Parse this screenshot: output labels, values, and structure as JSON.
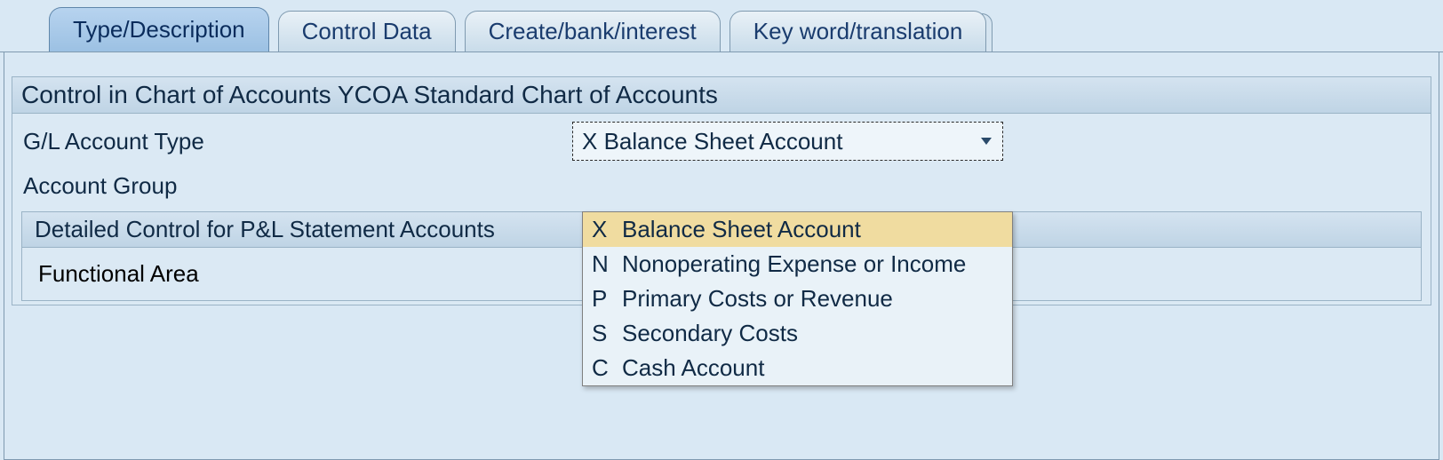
{
  "tabs": [
    {
      "label": "Type/Description",
      "active": true
    },
    {
      "label": "Control Data",
      "active": false
    },
    {
      "label": "Create/bank/interest",
      "active": false
    },
    {
      "label": "Key word/translation",
      "active": false
    }
  ],
  "group_header": "Control in Chart of Accounts YCOA Standard Chart of Accounts",
  "fields": {
    "gl_account_type_label": "G/L Account Type",
    "gl_account_type_value": "X  Balance Sheet Account",
    "account_group_label": "Account Group"
  },
  "inner": {
    "header": "Detailed Control for P&L Statement Accounts",
    "functional_area_label": "Functional Area"
  },
  "dropdown_items": [
    {
      "key": "X",
      "text": "Balance Sheet Account",
      "selected": true
    },
    {
      "key": "N",
      "text": "Nonoperating Expense or Income",
      "selected": false
    },
    {
      "key": "P",
      "text": "Primary Costs or Revenue",
      "selected": false
    },
    {
      "key": "S",
      "text": "Secondary Costs",
      "selected": false
    },
    {
      "key": "C",
      "text": "Cash Account",
      "selected": false
    }
  ]
}
